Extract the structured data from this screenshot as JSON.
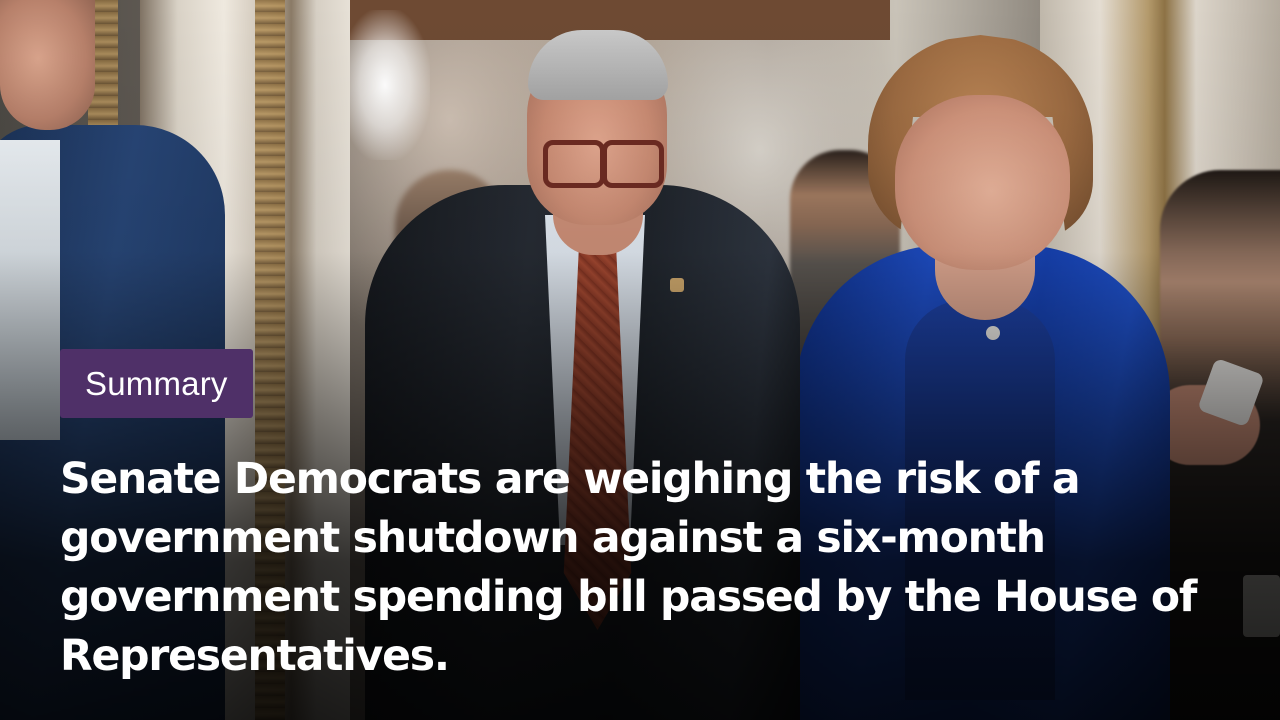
{
  "card": {
    "tag_label": "Summary",
    "headline": "Senate Democrats are weighing the risk of a government shutdown against a six-month government spending bill passed by the House of Representatives.",
    "colors": {
      "tag_background": "#4f3068",
      "text": "#ffffff"
    }
  }
}
